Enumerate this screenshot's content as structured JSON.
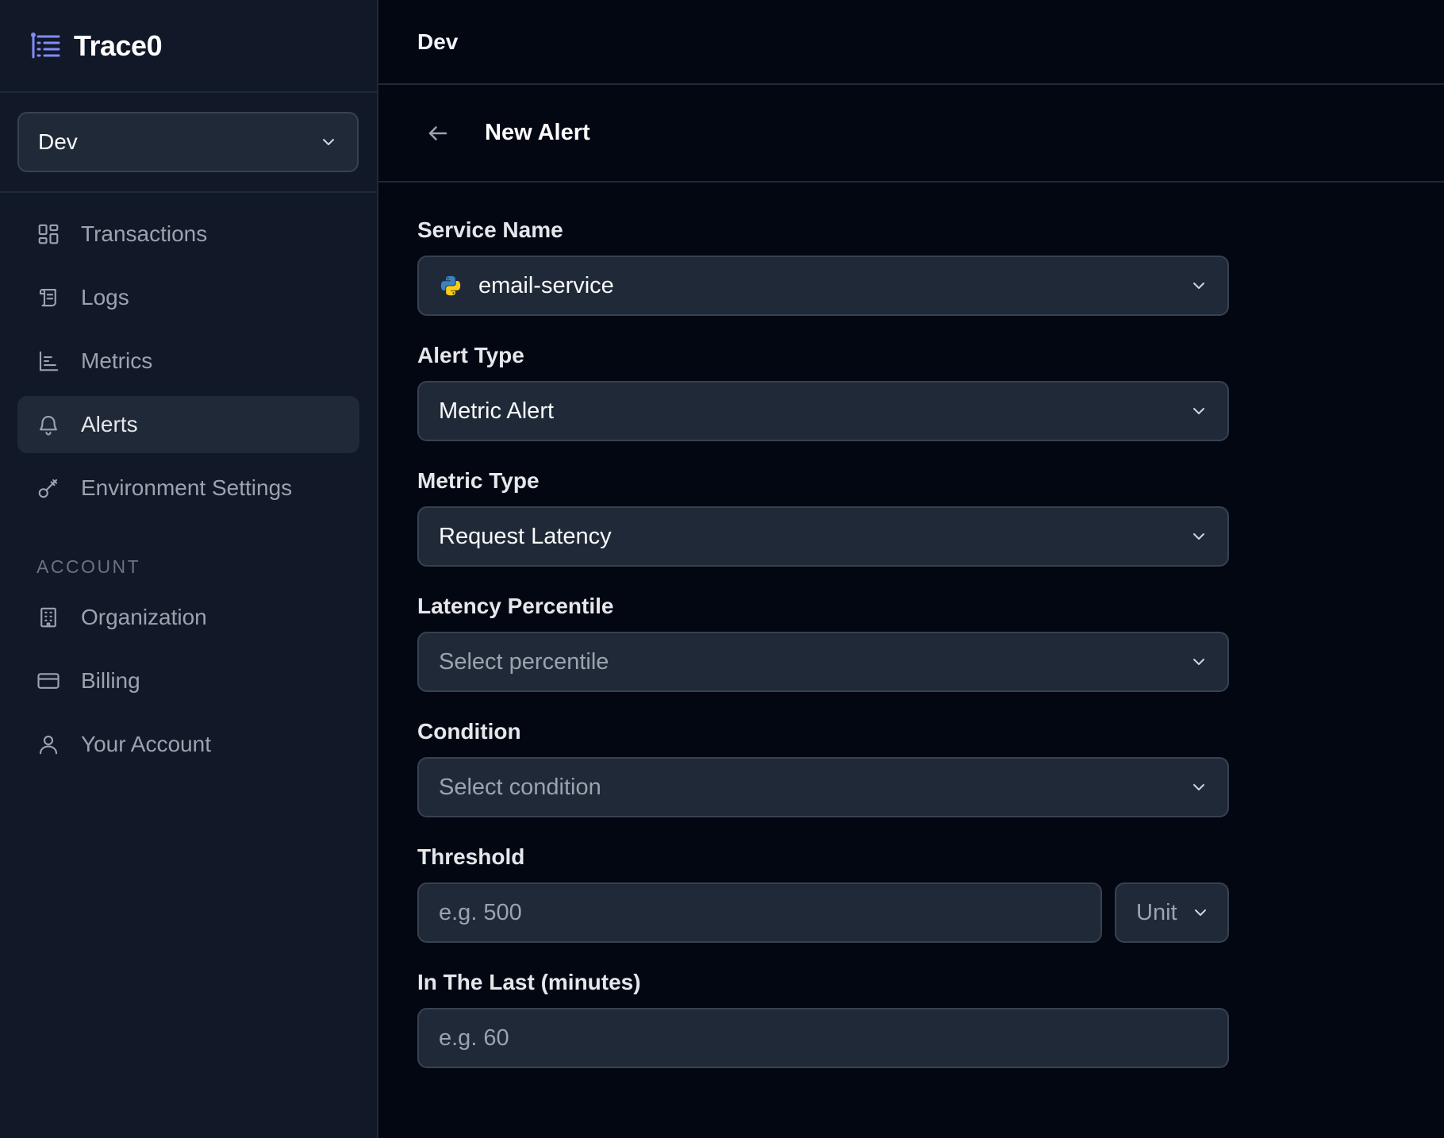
{
  "brand": {
    "name": "Trace0"
  },
  "env_select": {
    "value": "Dev"
  },
  "nav": [
    {
      "label": "Transactions",
      "icon": "grid-icon"
    },
    {
      "label": "Logs",
      "icon": "scroll-icon"
    },
    {
      "label": "Metrics",
      "icon": "bar-chart-icon"
    },
    {
      "label": "Alerts",
      "icon": "bell-icon",
      "active": true
    },
    {
      "label": "Environment Settings",
      "icon": "key-icon"
    }
  ],
  "account_section": {
    "label": "ACCOUNT",
    "items": [
      {
        "label": "Organization",
        "icon": "building-icon"
      },
      {
        "label": "Billing",
        "icon": "credit-card-icon"
      },
      {
        "label": "Your Account",
        "icon": "user-icon"
      }
    ]
  },
  "header": {
    "env": "Dev"
  },
  "page": {
    "title": "New Alert"
  },
  "form": {
    "service_name": {
      "label": "Service Name",
      "value": "email-service",
      "icon": "python-icon"
    },
    "alert_type": {
      "label": "Alert Type",
      "value": "Metric Alert"
    },
    "metric_type": {
      "label": "Metric Type",
      "value": "Request Latency"
    },
    "latency_percentile": {
      "label": "Latency Percentile",
      "placeholder": "Select percentile"
    },
    "condition": {
      "label": "Condition",
      "placeholder": "Select condition"
    },
    "threshold": {
      "label": "Threshold",
      "placeholder": "e.g. 500",
      "unit_placeholder": "Unit"
    },
    "window": {
      "label": "In The Last (minutes)",
      "placeholder": "e.g. 60"
    }
  },
  "colors": {
    "background": "#030712",
    "sidebar": "#111827",
    "field": "#1f2937",
    "border": "#374151",
    "accent": "#6366f1"
  }
}
